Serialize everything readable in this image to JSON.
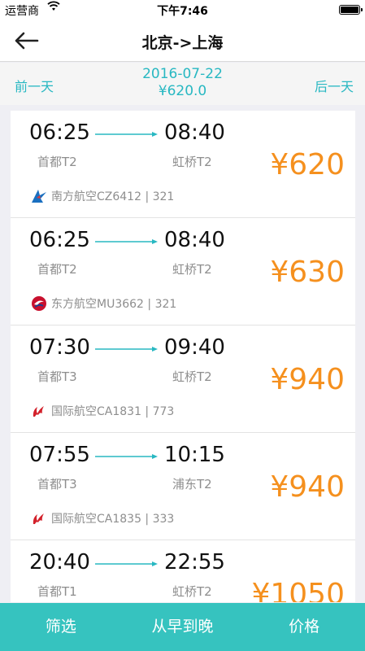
{
  "status": {
    "carrier": "运营商",
    "time": "下午7:46"
  },
  "nav": {
    "title": "北京->上海"
  },
  "datebar": {
    "prev_label": "前一天",
    "next_label": "后一天",
    "date": "2016-07-22",
    "lowest_price": "¥620.0"
  },
  "flights": [
    {
      "dep_time": "06:25",
      "arr_time": "08:40",
      "dep_airport": "首都T2",
      "arr_airport": "虹桥T2",
      "price": "¥620",
      "airline": "南方航空CZ6412 | 321",
      "logo": "china-southern-logo"
    },
    {
      "dep_time": "06:25",
      "arr_time": "08:40",
      "dep_airport": "首都T2",
      "arr_airport": "虹桥T2",
      "price": "¥630",
      "airline": "东方航空MU3662 | 321",
      "logo": "china-eastern-logo"
    },
    {
      "dep_time": "07:30",
      "arr_time": "09:40",
      "dep_airport": "首都T3",
      "arr_airport": "虹桥T2",
      "price": "¥940",
      "airline": "国际航空CA1831 | 773",
      "logo": "air-china-logo"
    },
    {
      "dep_time": "07:55",
      "arr_time": "10:15",
      "dep_airport": "首都T3",
      "arr_airport": "浦东T2",
      "price": "¥940",
      "airline": "国际航空CA1835 | 333",
      "logo": "air-china-logo"
    },
    {
      "dep_time": "20:40",
      "arr_time": "22:55",
      "dep_airport": "首都T1",
      "arr_airport": "虹桥T2",
      "price": "¥1050",
      "airline": "",
      "logo": ""
    }
  ],
  "bottom": {
    "filter_label": "筛选",
    "sort_label": "从早到晚",
    "price_label": "价格"
  },
  "colors": {
    "accent": "#28b8c2",
    "price": "#f5901e",
    "bottom_bar": "#36c3bf"
  }
}
